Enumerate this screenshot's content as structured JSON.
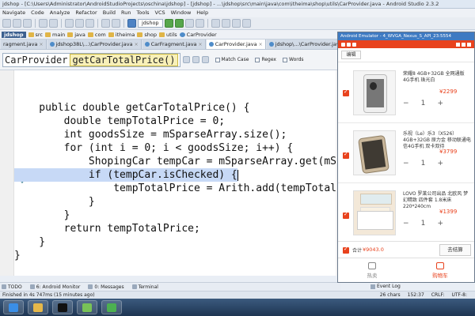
{
  "ide": {
    "title": "jdshop - [C:\\Users\\Administrator\\AndroidStudioProjects\\oschina\\jdshop] - [jdshop] - ...\\jdshop\\src\\main\\java\\com\\itheima\\shop\\utils\\CarProvider.java - Android Studio 2.3.2",
    "menu": [
      "Navigate",
      "Code",
      "Analyze",
      "Refactor",
      "Build",
      "Run",
      "Tools",
      "VCS",
      "Window",
      "Help"
    ],
    "run_config": "jdshop",
    "breadcrumb": [
      "jdshop",
      "src",
      "main",
      "java",
      "com",
      "itheima",
      "shop",
      "utils",
      "CarProvider"
    ],
    "tabs": [
      "ragment.java",
      "jdshop38L\\...\\CarProvider.java",
      "CarFragment.java",
      "CarProvider.java",
      "jdshop\\...\\CarProvider.java"
    ],
    "find": {
      "query": "CarProvider",
      "match": "getCarTotalPrice()",
      "match_case": "Match Case",
      "regex": "Regex",
      "words": "Words"
    },
    "code_lines": [
      "    public double getCarTotalPrice() {",
      "        double tempTotalPrice = 0;",
      "        int goodsSize = mSparseArray.size();",
      "        for (int i = 0; i < goodsSize; i++) {",
      "            ShopingCar tempCar = mSparseArray.get(mS",
      "            if (tempCar.isChecked) {",
      "                tempTotalPrice = Arith.add(tempTotal",
      "            }",
      "        }",
      "        return tempTotalPrice;",
      "    }",
      "}"
    ],
    "selected_line": 5,
    "bottom_tools": [
      "TODO",
      "6: Android Monitor",
      "0: Messages",
      "Terminal"
    ],
    "event_log": "Event Log",
    "status_left": "Finished in 4s 747ms (15 minutes ago)",
    "status_right": [
      "26 chars",
      "152:37",
      "CRLF:",
      "UTF-8:"
    ]
  },
  "emulator": {
    "title": "Android Emulator - 4_WVGA_Nexus_S_API_23:5554",
    "edit_label": "编辑",
    "items": [
      {
        "name": "荣耀8 4GB+32GB 全网通版 4G手机 珠光白",
        "price": "¥2299",
        "qty": "1",
        "img": "phone"
      },
      {
        "name": "乐视（Le）乐3（X526）4GB+32GB 原力金 移动联通电信4G手机 双卡双待",
        "price": "¥3799",
        "qty": "1",
        "img": "gold-phone"
      },
      {
        "name": "LOVO 罗莱公司出品 北欧风 梦幻精致 四件套 1.8米床 220*240cm",
        "price": "¥1399",
        "qty": "1",
        "img": "bedding"
      }
    ],
    "total_label": "合计",
    "total_value": "¥9043.0",
    "checkout_label": "去结算",
    "nav": [
      "热卖",
      "购物车"
    ],
    "accent": "#e8421d"
  }
}
